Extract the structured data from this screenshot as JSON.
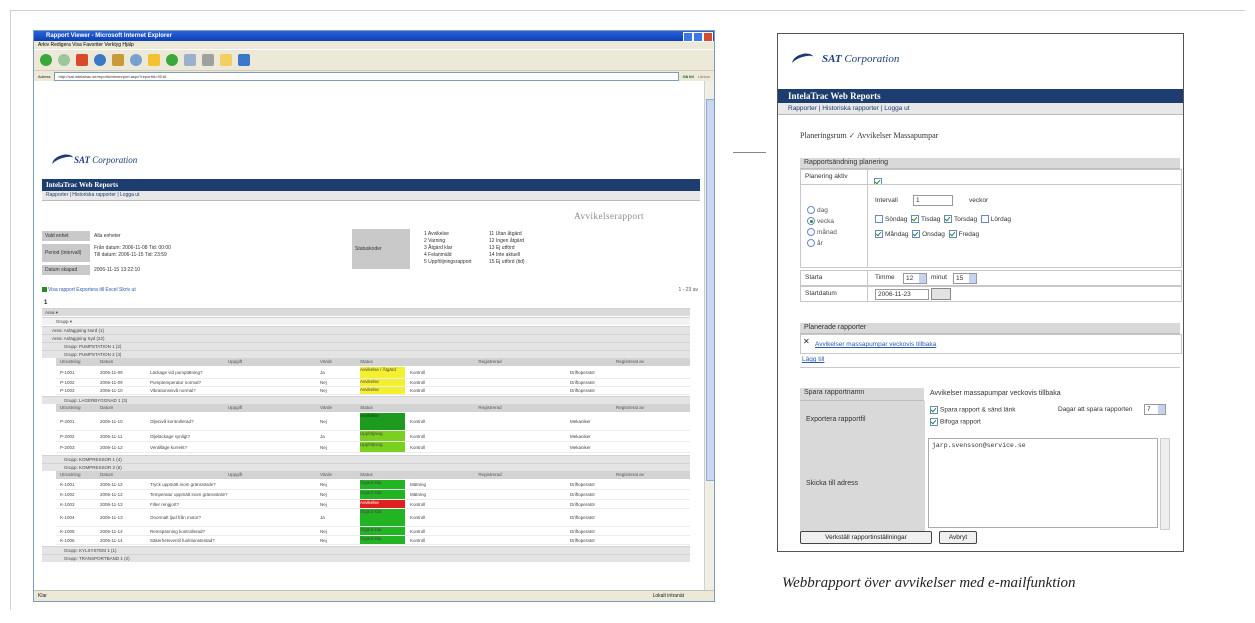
{
  "browser": {
    "title": "Rapport Viewer - Microsoft Internet Explorer",
    "menu": "Arkiv   Redigera   Visa   Favoriter   Verktyg   Hjälp",
    "address": "http://sat.intelatrac.se/reports/viewreport.aspx?reportId=9016",
    "go_label": "Gå till",
    "links_label": "Länkar",
    "status_left": "Klar",
    "status_right": "Lokalt intranät"
  },
  "left_report": {
    "brand_bold": "SAT",
    "brand_rest": " Corporation",
    "app_title": "IntelaTrac Web Reports",
    "nav": "Rapporter | Historiska rapporter | Logga ut",
    "report_title": "Avvikelserapport",
    "info": [
      {
        "label": "Vald enhet",
        "value": "Alla enheter"
      },
      {
        "label": "Period (intervall)",
        "value": "Från datum: 2006-11-08   Tid: 00:00\nTill datum: 2006-11-15   Tid: 23:59"
      },
      {
        "label": "Datum skapad",
        "value": "2006-11-15 13:22:10"
      }
    ],
    "status_label": "Statuskoder",
    "status_items_a": [
      "1 Avvikelse",
      "2 Varning",
      "3 Åtgärd klar",
      "4 Felanmäld",
      "5 Uppföljningsrapport"
    ],
    "status_items_b": [
      "11 Utan åtgärd",
      "12 Ingen åtgärd",
      "13 Ej utförd",
      "14 Inte aktuell",
      "15 Ej utförd (tid)"
    ],
    "actions": "Visa rapport   Exportera till Excel   Skriv ut",
    "paging": "1 - 23 av",
    "page_no": "1",
    "group_label": "Grupp",
    "area_label": "Area",
    "groups": [
      {
        "name": "Area: Anläggning Nord (1)",
        "type": "area"
      },
      {
        "name": "Area: Anläggning Syd (22)",
        "type": "area"
      },
      {
        "name": "Grupp: PUMPSTATION 1 (2)",
        "type": "group"
      },
      {
        "name": "Grupp: PUMPSTATION 2 (3)",
        "type": "group"
      }
    ],
    "headers": [
      "Utrustning",
      "Datum",
      "Uppgift",
      "Värde",
      "Status",
      "Registrerad",
      "Registrerat av"
    ],
    "rows_a": [
      {
        "eq": "P-1001",
        "date": "2006-11-09",
        "task": "Läckage vid pumptätning?",
        "val": "Ja",
        "status": "Avvikelse / Åtgärd",
        "reg": "Kontroll",
        "by": "Driftoperatör"
      },
      {
        "eq": "P-1002",
        "date": "2006-11-09",
        "task": "Pumptemperatur normal?",
        "val": "Nej",
        "status": "Avvikelse",
        "reg": "Kontroll",
        "by": "Driftoperatör"
      },
      {
        "eq": "P-1003",
        "date": "2006-11-10",
        "task": "Vibrationsnivå normal?",
        "val": "Nej",
        "status": "Avvikelse",
        "reg": "Kontroll",
        "by": "Driftoperatör"
      }
    ],
    "rows_b": [
      {
        "eq": "P-2001",
        "date": "2006-11-10",
        "task": "Oljenivå kontrollerad?",
        "val": "Nej",
        "status": "Avvikelse",
        "reg": "Kontroll",
        "by": "Mekaniker"
      },
      {
        "eq": "P-2002",
        "date": "2006-11-11",
        "task": "Oljeläckage synligt?",
        "val": "Ja",
        "status": "Uppföljning",
        "reg": "Kontroll",
        "by": "Mekaniker"
      },
      {
        "eq": "P-2003",
        "date": "2006-11-12",
        "task": "Ventilläge korrekt?",
        "val": "Nej",
        "status": "Uppföljning",
        "reg": "Kontroll",
        "by": "Mekaniker"
      }
    ],
    "groups_c": [
      {
        "name": "Grupp: KOMPRESSOR 1 (4)"
      },
      {
        "name": "Grupp: KOMPRESSOR 2 (6)"
      }
    ],
    "rows_c": [
      {
        "eq": "K-1001",
        "date": "2006-11-12",
        "task": "Tryck uppmätt inom gränsvärde?",
        "val": "Nej",
        "status": "Åtgärd klar",
        "reg": "Mätning",
        "by": "Driftoperatör"
      },
      {
        "eq": "K-1002",
        "date": "2006-11-12",
        "task": "Temperatur uppmätt inom gränsvärde?",
        "val": "Nej",
        "status": "Åtgärd klar",
        "reg": "Mätning",
        "by": "Driftoperatör"
      },
      {
        "eq": "K-1003",
        "date": "2006-11-13",
        "task": "Filter rengjort?",
        "val": "Nej",
        "status": "Avvikelse",
        "reg": "Kontroll",
        "by": "Driftoperatör"
      },
      {
        "eq": "K-1004",
        "date": "2006-11-13",
        "task": "Onormalt ljud från motor?",
        "val": "Ja",
        "status": "Åtgärd klar",
        "reg": "Kontroll",
        "by": "Driftoperatör"
      },
      {
        "eq": "K-1005",
        "date": "2006-11-14",
        "task": "Remspänning kontrollerad?",
        "val": "Nej",
        "status": "Åtgärd klar",
        "reg": "Kontroll",
        "by": "Driftoperatör"
      },
      {
        "eq": "K-1006",
        "date": "2006-11-14",
        "task": "Säkerhetsventil funktionstestad?",
        "val": "Nej",
        "status": "Åtgärd klar",
        "reg": "Kontroll",
        "by": "Driftoperatör"
      }
    ],
    "groups_d": [
      {
        "name": "Grupp: KYLSYSTEM 1 (1)"
      },
      {
        "name": "Grupp: TRANSPORTBAND 1 (2)"
      }
    ]
  },
  "panel": {
    "brand_bold": "SAT",
    "brand_rest": " Corporation",
    "app_title": "IntelaTrac Web Reports",
    "nav": "Rapporter | Historiska rapporter | Logga ut",
    "breadcrumb_a": "Planeringsrum",
    "breadcrumb_sep": "✓",
    "breadcrumb_b": "Avvikelser Massapumpar",
    "schedule_header": "Rapportsändning planering",
    "schedule_active_label": "Planering aktiv",
    "interval_label": "Intervall",
    "interval_value": "1",
    "interval_unit": "veckor",
    "freq_options": [
      "dag",
      "vecka",
      "månad",
      "år"
    ],
    "days_row1": [
      "Söndag",
      "Tisdag",
      "Torsdag",
      "Lördag"
    ],
    "days_row2": [
      "Måndag",
      "Onsdag",
      "Fredag"
    ],
    "start_label": "Starta",
    "start_time_prefix": "Timme",
    "start_hour": "12",
    "start_min_prefix": "minut",
    "start_min": "15",
    "start_date_label": "Startdatum",
    "start_date": "2006-11-23",
    "planned_header": "Planerade rapporter",
    "planned_item": "Avvikelser massapumpar veckovis tillbaka",
    "add_link": "Lägg till",
    "name_label": "Spara rapportnamn",
    "name_value": "Avvikelser massapumpar veckovis tillbaka",
    "export_label": "Exportera rapportfil",
    "save_option": "Spara rapport & sänd länk",
    "days_to_save_label": "Dagar att spara rapporten",
    "days_to_save": "7",
    "attach_option": "Bifoga rapport",
    "recipients_label": "Skicka till adress",
    "recipients_value": "jarp.svensson@service.se",
    "save_button": "Verkställ rapportinställningar",
    "cancel_button": "Avbryt"
  },
  "caption": "Webbrapport över avvikelser med e-mailfunktion"
}
